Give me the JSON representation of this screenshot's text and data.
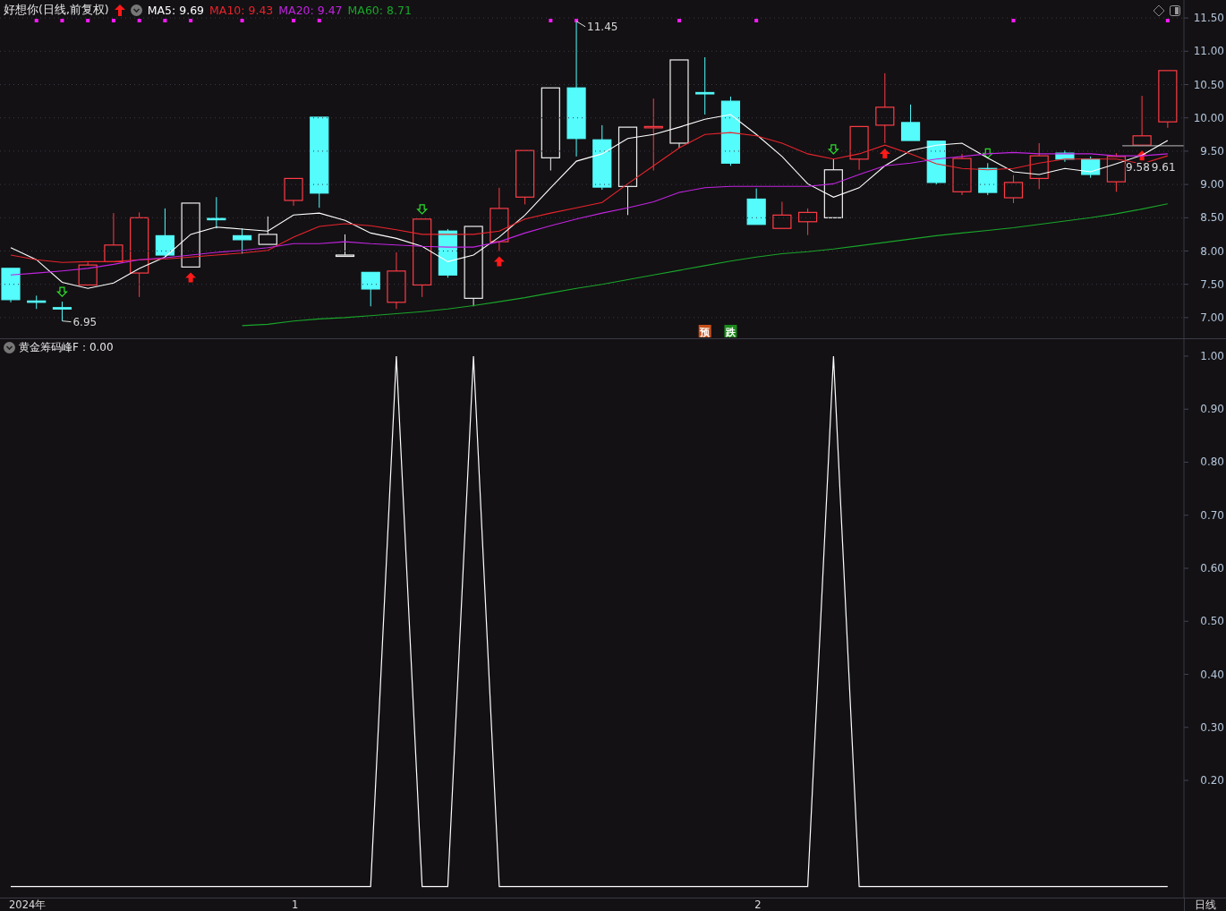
{
  "header": {
    "title": "好想你(日线,前复权)",
    "legend": [
      ": 9.69",
      ": 9.43",
      ": 9.47",
      ": 8.71"
    ]
  },
  "main_chart": {
    "chart_data": {
      "type": "line",
      "grid": true,
      "ylim": [
        6.69,
        11.77
      ],
      "yticks": [
        {
          "value": 7,
          "label": "7.00"
        },
        {
          "value": 7.5,
          "label": "7.50"
        },
        {
          "value": 8,
          "label": "8.00"
        },
        {
          "value": 8.5,
          "label": "8.50"
        },
        {
          "value": 9,
          "label": "9.00"
        },
        {
          "value": 9.5,
          "label": "9.50"
        },
        {
          "value": 10,
          "label": "10.00"
        },
        {
          "value": 10.5,
          "label": "10.50"
        },
        {
          "value": 11,
          "label": "11.00"
        },
        {
          "value": 11.5,
          "label": "11.50"
        }
      ],
      "series": [
        {
          "name": "MA5",
          "color": "#ffffff",
          "values": [
            8.05,
            7.87,
            7.53,
            7.44,
            7.52,
            7.74,
            7.91,
            8.25,
            8.36,
            8.33,
            8.3,
            8.54,
            8.57,
            8.46,
            8.27,
            8.19,
            8.07,
            7.84,
            7.94,
            8.21,
            8.54,
            8.95,
            9.35,
            9.46,
            9.69,
            9.75,
            9.86,
            9.98,
            10.05,
            9.75,
            9.42,
            9.01,
            8.81,
            8.95,
            9.28,
            9.51,
            9.59,
            9.62,
            9.4,
            9.19,
            9.15,
            9.24,
            9.19,
            9.31,
            9.44,
            9.66
          ]
        },
        {
          "name": "MA10",
          "color": "#e8242c",
          "values": [
            7.94,
            7.87,
            7.83,
            7.84,
            7.84,
            7.87,
            7.88,
            7.91,
            7.94,
            7.97,
            8.01,
            8.21,
            8.37,
            8.41,
            8.38,
            8.32,
            8.25,
            8.25,
            8.25,
            8.3,
            8.48,
            8.57,
            8.65,
            8.73,
            9.01,
            9.28,
            9.55,
            9.75,
            9.78,
            9.73,
            9.62,
            9.46,
            9.38,
            9.46,
            9.59,
            9.46,
            9.31,
            9.24,
            9.22,
            9.24,
            9.32,
            9.38,
            9.38,
            9.38,
            9.31,
            9.43
          ]
        },
        {
          "name": "MA20",
          "color": "#c224e0",
          "values": [
            7.64,
            7.67,
            7.7,
            7.74,
            7.8,
            7.87,
            7.9,
            7.94,
            7.98,
            8.01,
            8.05,
            8.11,
            8.11,
            8.14,
            8.11,
            8.09,
            8.07,
            8.06,
            8.06,
            8.14,
            8.27,
            8.38,
            8.48,
            8.57,
            8.65,
            8.74,
            8.88,
            8.95,
            8.97,
            8.97,
            8.97,
            8.97,
            9.01,
            9.15,
            9.28,
            9.32,
            9.38,
            9.42,
            9.46,
            9.48,
            9.46,
            9.46,
            9.46,
            9.43,
            9.43,
            9.46
          ]
        },
        {
          "name": "MA60",
          "color": "#1aa62a",
          "values": [
            null,
            null,
            null,
            null,
            null,
            null,
            null,
            null,
            null,
            6.88,
            6.9,
            6.95,
            6.98,
            7.0,
            7.03,
            7.06,
            7.09,
            7.13,
            7.18,
            7.24,
            7.3,
            7.37,
            7.44,
            7.5,
            7.57,
            7.64,
            7.71,
            7.78,
            7.85,
            7.91,
            7.96,
            7.99,
            8.03,
            8.08,
            8.13,
            8.18,
            8.23,
            8.27,
            8.31,
            8.35,
            8.4,
            8.45,
            8.5,
            8.56,
            8.63,
            8.71
          ]
        }
      ]
    },
    "price_labels": [
      "11.45",
      "6.95",
      "9.58",
      "9.61"
    ],
    "signal_tags": [
      {
        "text": "预",
        "color": "#c8501a"
      },
      {
        "text": "跌",
        "color": "#1a8a1a"
      }
    ]
  },
  "indicator": {
    "value": "：0.00",
    "chart_data": {
      "type": "line",
      "ylim": [
        -0.021,
        1.032
      ],
      "yticks": [
        {
          "value": 0.2,
          "label": "0.20"
        },
        {
          "value": 0.3,
          "label": "0.30"
        },
        {
          "value": 0.4,
          "label": "0.40"
        },
        {
          "value": 0.5,
          "label": "0.50"
        },
        {
          "value": 0.6,
          "label": "0.60"
        },
        {
          "value": 0.7,
          "label": "0.70"
        },
        {
          "value": 0.8,
          "label": "0.80"
        },
        {
          "value": 0.9,
          "label": "0.90"
        },
        {
          "value": 1.0,
          "label": "1.00"
        }
      ],
      "series": [
        {
          "name": "黄金筹码峰F",
          "color": "#ffffff",
          "values": [
            0,
            0,
            0,
            0,
            0,
            0,
            0,
            0,
            0,
            0,
            0,
            0,
            0,
            0,
            0,
            1,
            0,
            0,
            1,
            0,
            0,
            0,
            0,
            0,
            0,
            0,
            0,
            0,
            0,
            0,
            0,
            0,
            1,
            0,
            0,
            0,
            0,
            0,
            0,
            0,
            0,
            0,
            0,
            0,
            0,
            0
          ]
        }
      ]
    }
  },
  "time_axis": {
    "labels": [
      "2024年",
      "1",
      "2"
    ],
    "period": "日线"
  }
}
